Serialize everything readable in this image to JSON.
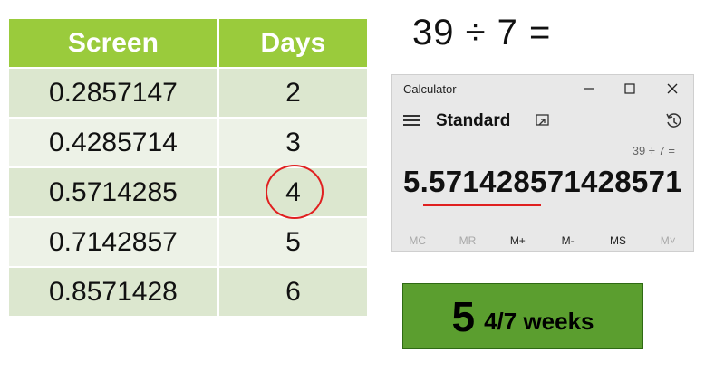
{
  "table": {
    "headers": [
      "Screen",
      "Days"
    ],
    "rows": [
      {
        "screen": "0.2857147",
        "days": "2"
      },
      {
        "screen": "0.4285714",
        "days": "3"
      },
      {
        "screen": "0.5714285",
        "days": "4"
      },
      {
        "screen": "0.7142857",
        "days": "5"
      },
      {
        "screen": "0.8571428",
        "days": "6"
      }
    ],
    "highlighted_days": "4",
    "colors": {
      "header": "#9ACB3C",
      "row_odd": "#DCE7CF",
      "row_even": "#EDF2E7",
      "circle": "#E02020"
    }
  },
  "equation": "39 ÷ 7 =",
  "calculator": {
    "title": "Calculator",
    "window_buttons": {
      "minimize": "—",
      "maximize": "☐",
      "close": "✕"
    },
    "mode": "Standard",
    "expression": "39 ÷ 7 =",
    "result": "5.571428571428571",
    "memory_buttons": [
      "MC",
      "MR",
      "M+",
      "M-",
      "MS",
      "M˅"
    ],
    "icons": {
      "menu": "hamburger-icon",
      "keep_on_top": "keep-on-top-icon",
      "history": "history-icon"
    }
  },
  "answer": {
    "whole": "5",
    "fraction_unit": "4/7 weeks",
    "color": "#5B9E2F"
  }
}
